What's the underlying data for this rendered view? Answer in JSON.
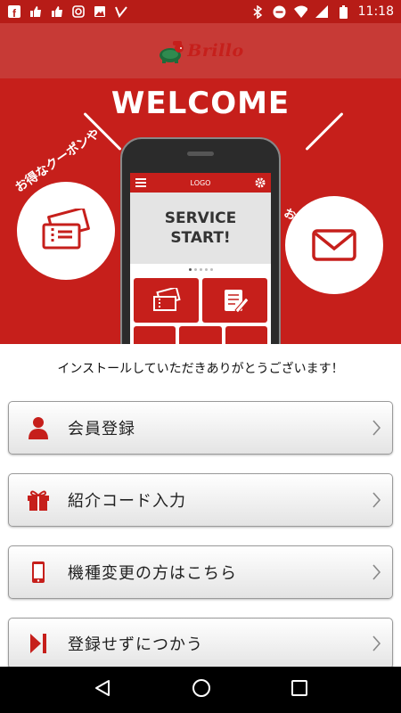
{
  "status_bar": {
    "time": "11:18",
    "left_icons": [
      "facebook-icon",
      "thumbs-up-icon",
      "thumbs-up-icon",
      "instagram-icon",
      "image-icon",
      "vine-icon"
    ],
    "right_icons": [
      "bluetooth-icon",
      "do-not-disturb-icon",
      "wifi-icon",
      "signal-icon",
      "battery-icon"
    ]
  },
  "header": {
    "logo_text": "Brillo"
  },
  "hero": {
    "welcome": "WELCOME",
    "coupon_caption": "お得なクーポンや",
    "news_caption": "お店の情報が届く!",
    "phone": {
      "logo": "LOGO",
      "line1": "SERVICE",
      "line2": "START!"
    }
  },
  "thanks_text": "インストールしていただきありがとうございます！",
  "menu": [
    {
      "label": "会員登録",
      "icon": "person-icon"
    },
    {
      "label": "紹介コード入力",
      "icon": "gift-icon"
    },
    {
      "label": "機種変更の方はこちら",
      "icon": "phone-icon"
    },
    {
      "label": "登録せずにつかう",
      "icon": "skip-icon"
    }
  ],
  "colors": {
    "brand_red": "#c61f1b",
    "header_red": "#c73a36",
    "status_red": "#b71c17"
  },
  "navbar": [
    "back-icon",
    "home-icon",
    "recents-icon"
  ]
}
